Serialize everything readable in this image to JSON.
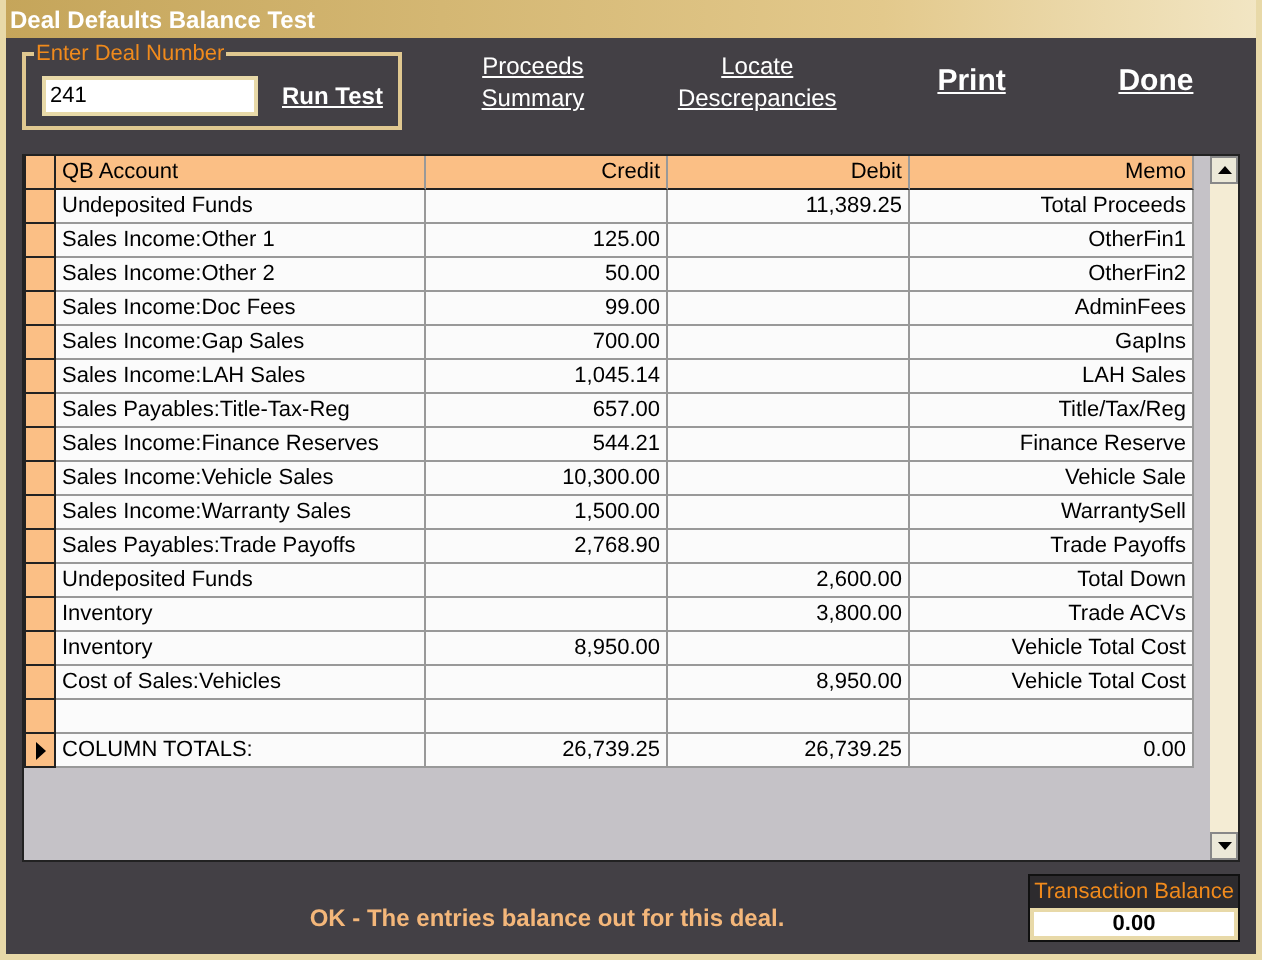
{
  "window": {
    "title": "Deal Defaults Balance Test"
  },
  "deal_group": {
    "legend": "Enter Deal Number",
    "deal_number": "241",
    "run_button": "Run Test"
  },
  "links": [
    {
      "label": "Proceeds Summary",
      "kind": "small"
    },
    {
      "label": "Locate Descrepancies",
      "kind": "small"
    },
    {
      "label": "Print",
      "kind": "big"
    },
    {
      "label": "Done",
      "kind": "big"
    }
  ],
  "table": {
    "columns": [
      "QB Account",
      "Credit",
      "Debit",
      "Memo"
    ],
    "rows": [
      {
        "selected": false,
        "account": "Undeposited Funds",
        "debit": "11,389.25",
        "memo": "Total Proceeds"
      },
      {
        "selected": false,
        "account": "Sales Income:Other 1",
        "credit": "125.00",
        "memo": "OtherFin1"
      },
      {
        "selected": false,
        "account": "Sales Income:Other 2",
        "credit": "50.00",
        "memo": "OtherFin2"
      },
      {
        "selected": false,
        "account": "Sales Income:Doc Fees",
        "credit": "99.00",
        "memo": "AdminFees"
      },
      {
        "selected": false,
        "account": "Sales Income:Gap Sales",
        "credit": "700.00",
        "memo": "GapIns"
      },
      {
        "selected": false,
        "account": "Sales Income:LAH Sales",
        "credit": "1,045.14",
        "memo": "LAH Sales"
      },
      {
        "selected": false,
        "account": "Sales Payables:Title-Tax-Reg",
        "credit": "657.00",
        "memo": "Title/Tax/Reg"
      },
      {
        "selected": false,
        "account": "Sales Income:Finance Reserves",
        "credit": "544.21",
        "memo": "Finance Reserve"
      },
      {
        "selected": false,
        "account": "Sales Income:Vehicle Sales",
        "credit": "10,300.00",
        "memo": "Vehicle Sale"
      },
      {
        "selected": false,
        "account": "Sales Income:Warranty Sales",
        "credit": "1,500.00",
        "memo": "WarrantySell"
      },
      {
        "selected": false,
        "account": "Sales Payables:Trade Payoffs",
        "credit": "2,768.90",
        "memo": "Trade Payoffs"
      },
      {
        "selected": false,
        "account": "Undeposited Funds",
        "debit": "2,600.00",
        "memo": "Total Down"
      },
      {
        "selected": false,
        "account": "Inventory",
        "debit": "3,800.00",
        "memo": "Trade ACVs"
      },
      {
        "selected": false,
        "account": "Inventory",
        "credit": "8,950.00",
        "memo": "Vehicle Total Cost"
      },
      {
        "selected": false,
        "account": "Cost of Sales:Vehicles",
        "debit": "8,950.00",
        "memo": "Vehicle Total Cost"
      },
      {
        "selected": false
      },
      {
        "selected": true,
        "account": "COLUMN TOTALS:",
        "credit": "26,739.25",
        "debit": "26,739.25",
        "memo": "0.00"
      }
    ]
  },
  "status_message": "OK - The entries balance out for this deal.",
  "transaction_balance": {
    "label": "Transaction Balance",
    "value": "0.00"
  }
}
